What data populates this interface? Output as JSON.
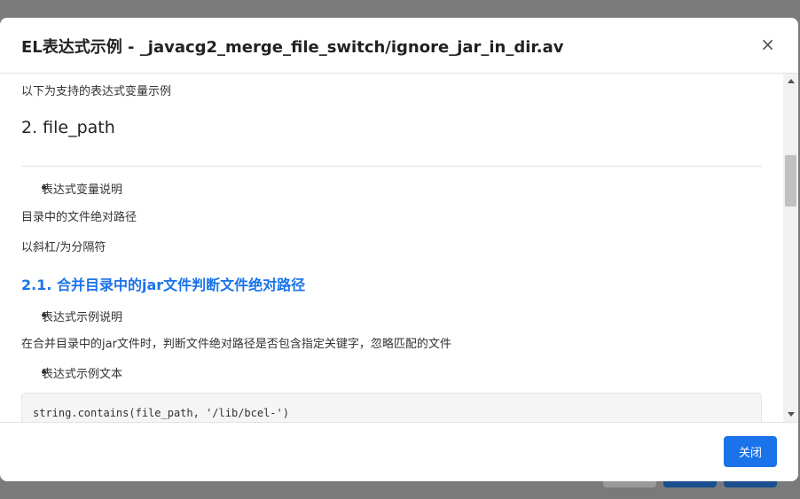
{
  "modal": {
    "title": "EL表达式示例 - _javacg2_merge_file_switch/ignore_jar_in_dir.av",
    "close_icon": "×",
    "footer_button": "关闭"
  },
  "body": {
    "intro": "以下为支持的表达式变量示例",
    "section_title": "2. file_path",
    "var_desc_bullet": "表达式变量说明",
    "var_desc_line1": "目录中的文件绝对路径",
    "var_desc_line2": "以斜杠/为分隔符",
    "subsection_title": "2.1. 合并目录中的jar文件判断文件绝对路径",
    "example_desc_bullet": "表达式示例说明",
    "example_desc_text": "在合并目录中的jar文件时，判断文件绝对路径是否包含指定关键字，忽略匹配的文件",
    "example_text_bullet": "表达式示例文本",
    "code": "string.contains(file_path, '/lib/bcel-')"
  },
  "colors": {
    "accent": "#1a73e8",
    "overlay": "#7a7a7a"
  }
}
